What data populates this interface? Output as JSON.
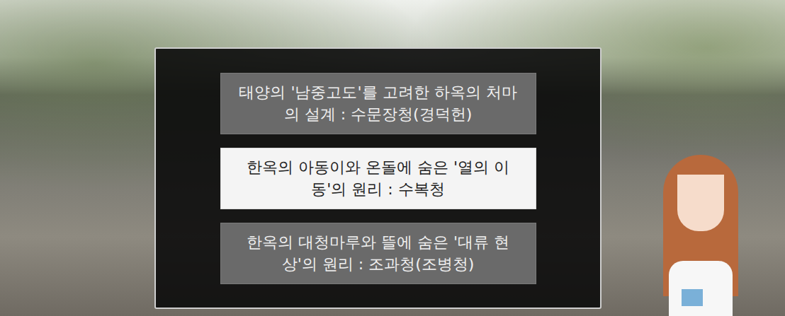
{
  "choices": [
    {
      "text": "태양의 '남중고도'를 고려한 하옥의 처마의 설계 : 수문장청(경덕헌)",
      "selected": false
    },
    {
      "text": "한옥의 아동이와 온돌에 숨은 '열의 이동'의 원리 : 수복청",
      "selected": true
    },
    {
      "text": "한옥의 대청마루와 뜰에 숨은 '대류 현상'의 원리 : 조과청(조병청)",
      "selected": false
    }
  ]
}
